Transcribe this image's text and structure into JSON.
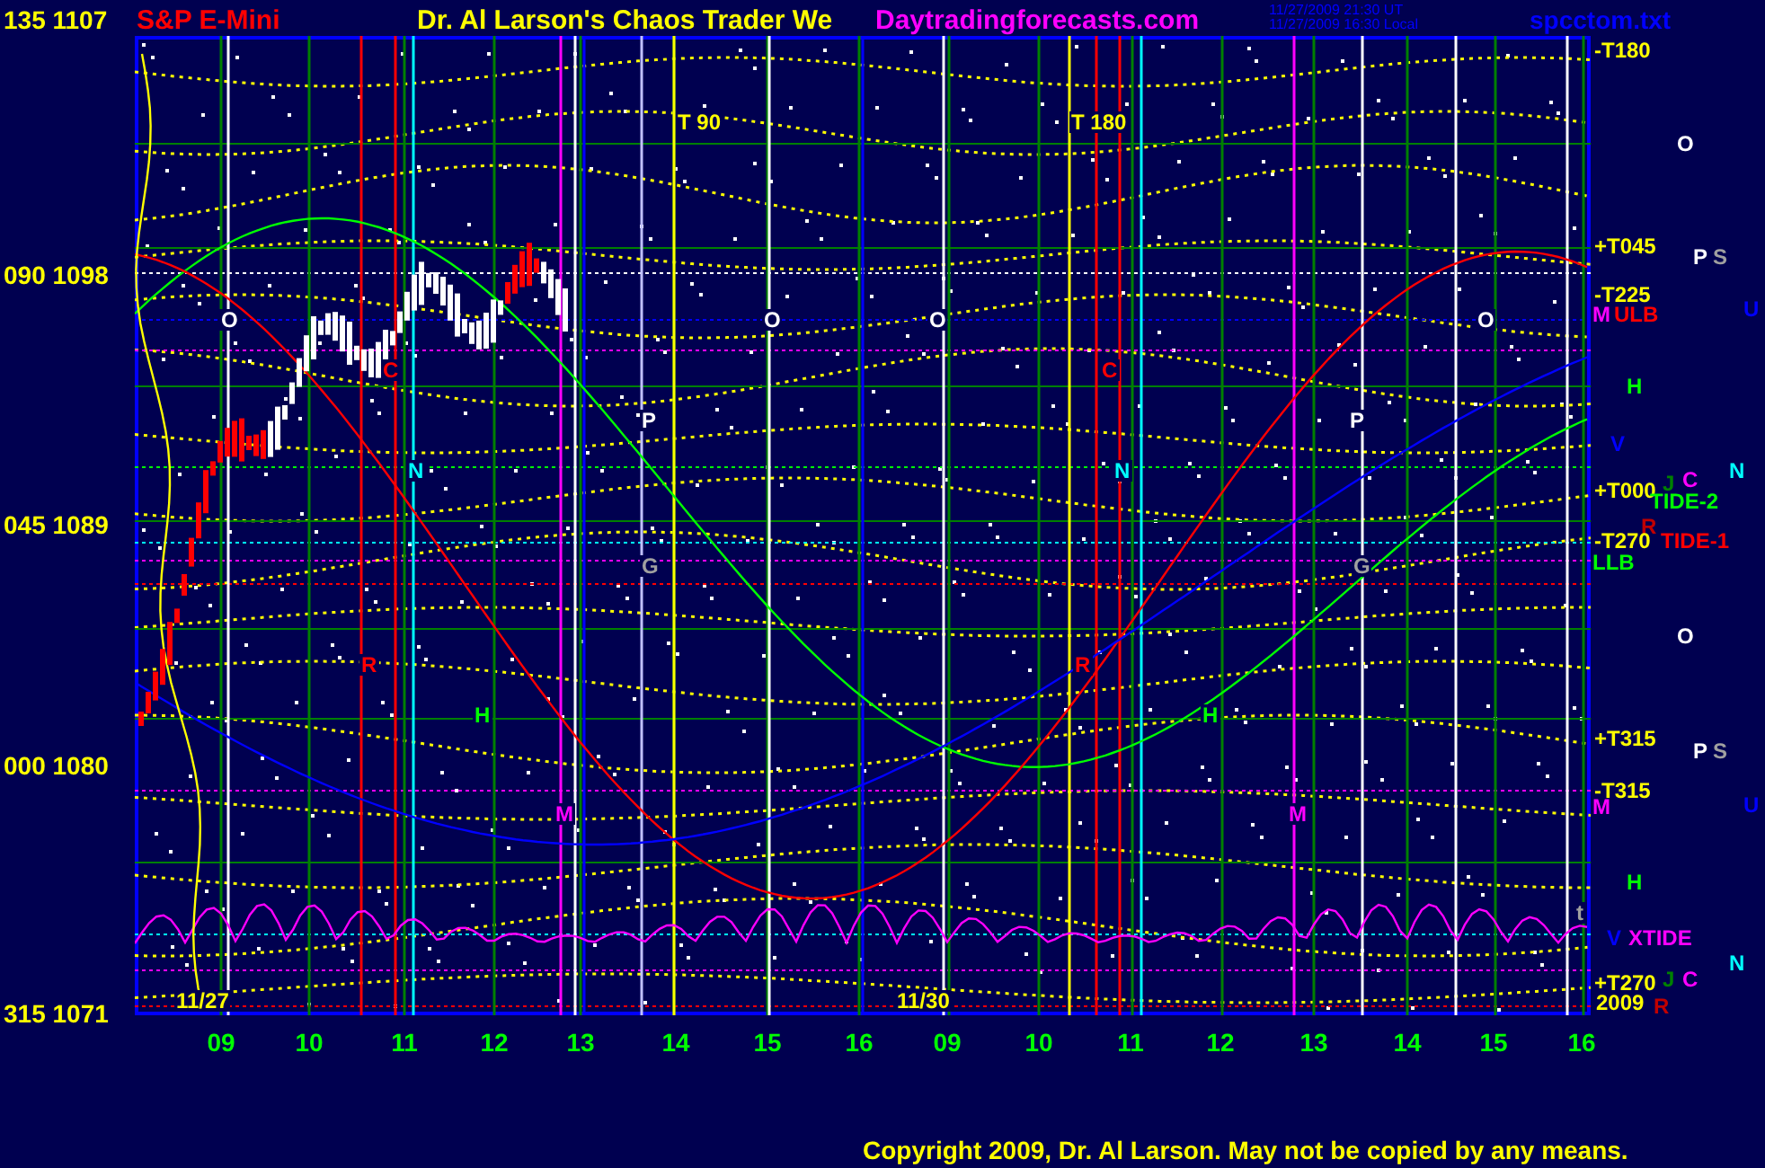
{
  "header": {
    "symbol": "S&P E-Mini",
    "title": "Dr. Al Larson's Chaos Trader We",
    "site": "Daytradingforecasts.com",
    "timestamps": [
      "11/27/2009 21:30 UT",
      "11/27/2009 16:30 Local"
    ],
    "file": "spcctom.txt"
  },
  "price_axis": [
    "135 1107",
    "090 1098",
    "045 1089",
    "000 1080",
    "315 1071"
  ],
  "plot_labels": [
    {
      "text": "T 90",
      "color": "#ffff00"
    },
    {
      "text": "T 180",
      "color": "#ffff00"
    },
    {
      "text": "O",
      "color": "#ffffff"
    },
    {
      "text": "O",
      "color": "#ffffff"
    },
    {
      "text": "O",
      "color": "#ffffff"
    },
    {
      "text": "O",
      "color": "#ffffff"
    },
    {
      "text": "C",
      "color": "#ff0000"
    },
    {
      "text": "C",
      "color": "#ff0000"
    },
    {
      "text": "N",
      "color": "#00ffff"
    },
    {
      "text": "N",
      "color": "#00ffff"
    },
    {
      "text": "P",
      "color": "#ffffff"
    },
    {
      "text": "P",
      "color": "#ffffff"
    },
    {
      "text": "G",
      "color": "#a0a0a0"
    },
    {
      "text": "G",
      "color": "#a0a0a0"
    },
    {
      "text": "R",
      "color": "#ff0000"
    },
    {
      "text": "R",
      "color": "#ff0000"
    },
    {
      "text": "H",
      "color": "#00ff00"
    },
    {
      "text": "H",
      "color": "#00ff00"
    },
    {
      "text": "M",
      "color": "#ff00ff"
    },
    {
      "text": "M",
      "color": "#ff00ff"
    },
    {
      "text": "t",
      "color": "#a0a0a0"
    },
    {
      "text": "11/27",
      "color": "#ffff00"
    },
    {
      "text": "11/30",
      "color": "#ffff00"
    }
  ],
  "side_labels": [
    {
      "text": "-T180",
      "color": "#ffff00"
    },
    {
      "text": "O",
      "color": "#ffffff"
    },
    {
      "text": "+T045",
      "color": "#ffff00"
    },
    {
      "text": "P",
      "color": "#ffffff"
    },
    {
      "text": "S",
      "color": "#a0a0a0"
    },
    {
      "text": "-T225",
      "color": "#ffff00"
    },
    {
      "text": "M",
      "color": "#ff00ff"
    },
    {
      "text": "ULB",
      "color": "#ff0000"
    },
    {
      "text": "U",
      "color": "#0000ff"
    },
    {
      "text": "H",
      "color": "#00ff00"
    },
    {
      "text": "V",
      "color": "#0000ff"
    },
    {
      "text": "N",
      "color": "#00ffff"
    },
    {
      "text": "J",
      "color": "#008000"
    },
    {
      "text": "C",
      "color": "#ff00ff"
    },
    {
      "text": "+T000",
      "color": "#ffff00"
    },
    {
      "text": "TIDE-2",
      "color": "#00ff00"
    },
    {
      "text": "R",
      "color": "#c00000"
    },
    {
      "text": "-T270",
      "color": "#ffff00"
    },
    {
      "text": "TIDE-1",
      "color": "#ff0000"
    },
    {
      "text": "LLB",
      "color": "#00ff00"
    },
    {
      "text": "O",
      "color": "#ffffff"
    },
    {
      "text": "+T315",
      "color": "#ffff00"
    },
    {
      "text": "P",
      "color": "#ffffff"
    },
    {
      "text": "S",
      "color": "#a0a0a0"
    },
    {
      "text": "-T315",
      "color": "#ffff00"
    },
    {
      "text": "M",
      "color": "#ff00ff"
    },
    {
      "text": "U",
      "color": "#0000ff"
    },
    {
      "text": "H",
      "color": "#00ff00"
    },
    {
      "text": "V",
      "color": "#0000ff"
    },
    {
      "text": "XTIDE",
      "color": "#ff00ff"
    },
    {
      "text": "N",
      "color": "#00ffff"
    },
    {
      "text": "+T270",
      "color": "#ffff00"
    },
    {
      "text": "J",
      "color": "#008000"
    },
    {
      "text": "C",
      "color": "#ff00ff"
    },
    {
      "text": "2009",
      "color": "#ffff00"
    },
    {
      "text": "R",
      "color": "#c00000"
    }
  ],
  "time_axis": [
    "09",
    "10",
    "11",
    "12",
    "13",
    "14",
    "15",
    "16",
    "09",
    "10",
    "11",
    "12",
    "13",
    "14",
    "15",
    "16"
  ],
  "copyright": "Copyright 2009, Dr. Al Larson. May not be copied by any means."
}
